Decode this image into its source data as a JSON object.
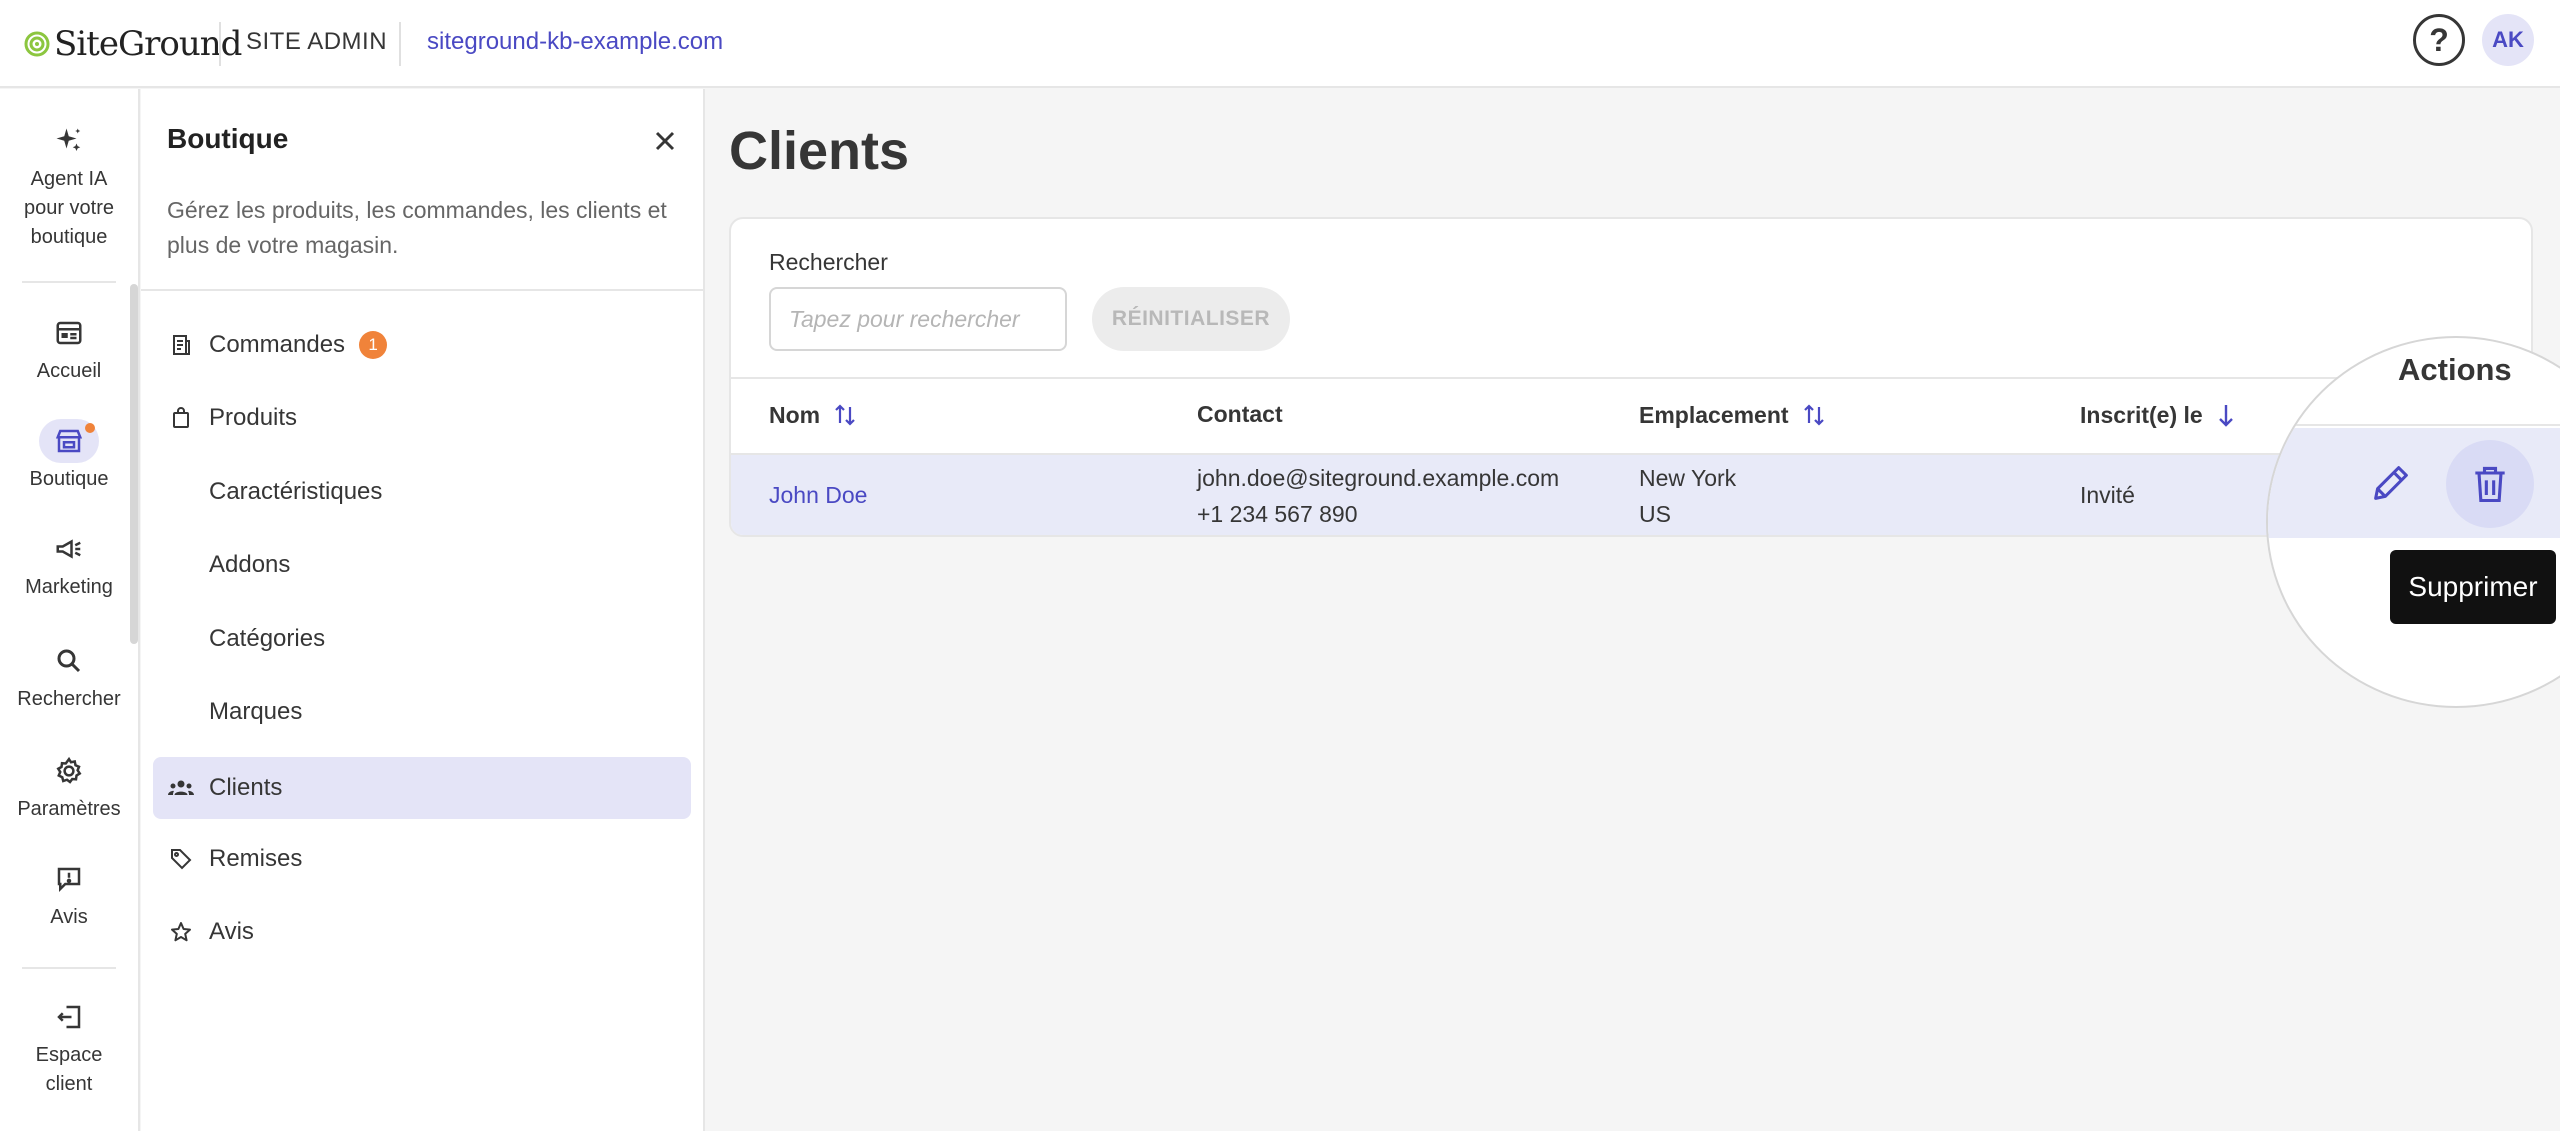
{
  "topbar": {
    "logo_text": "SiteGround",
    "section_label": "SITE ADMIN",
    "domain": "siteground-kb-example.com",
    "help_glyph": "?",
    "user_initials": "AK"
  },
  "rail": {
    "items": [
      {
        "label": "Agent IA pour votre boutique",
        "icon": "sparkle-icon"
      },
      {
        "label": "Accueil",
        "icon": "dashboard-icon"
      },
      {
        "label": "Boutique",
        "icon": "store-icon",
        "active": true,
        "has_notification": true
      },
      {
        "label": "Marketing",
        "icon": "megaphone-icon"
      },
      {
        "label": "Rechercher",
        "icon": "search-icon"
      },
      {
        "label": "Paramètres",
        "icon": "gear-icon"
      },
      {
        "label": "Avis",
        "icon": "feedback-icon"
      },
      {
        "label": "Espace client",
        "icon": "exit-icon"
      }
    ]
  },
  "panel": {
    "title": "Boutique",
    "description": "Gérez les produits, les commandes, les clients et plus de votre magasin.",
    "menu": [
      {
        "label": "Commandes",
        "icon": "receipt-icon",
        "badge": "1"
      },
      {
        "label": "Produits",
        "icon": "bag-icon"
      },
      {
        "label": "Caractéristiques"
      },
      {
        "label": "Addons"
      },
      {
        "label": "Catégories"
      },
      {
        "label": "Marques"
      },
      {
        "label": "Clients",
        "icon": "people-icon",
        "active": true
      },
      {
        "label": "Remises",
        "icon": "tag-icon"
      },
      {
        "label": "Avis",
        "icon": "star-icon"
      }
    ]
  },
  "main": {
    "title": "Clients",
    "search": {
      "label": "Rechercher",
      "placeholder": "Tapez pour rechercher",
      "value": ""
    },
    "reset_label": "RÉINITIALISER",
    "columns": [
      "Nom",
      "Contact",
      "Emplacement",
      "Inscrit(e) le",
      "Actions"
    ],
    "rows": [
      {
        "name": "John Doe",
        "email": "john.doe@siteground.example.com",
        "phone": "+1 234 567 890",
        "city": "New York",
        "country": "US",
        "registered": "Invité"
      }
    ],
    "tooltip": "Supprimer"
  },
  "colors": {
    "accent": "#4a49c3",
    "accent_light": "#e4e4f7",
    "badge": "#f0833a",
    "row_highlight": "#e8eaf8"
  }
}
